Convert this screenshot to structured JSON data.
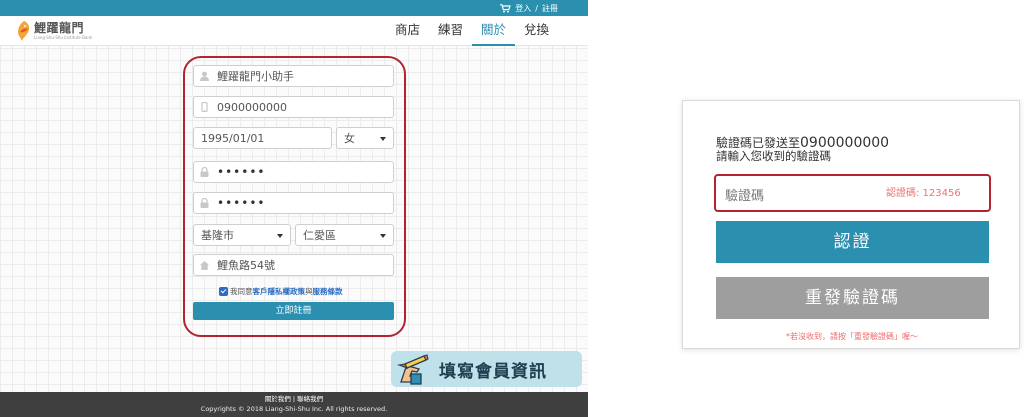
{
  "site": {
    "topbar": {
      "cart_icon": "cart-icon",
      "login_label": "登入",
      "separator": "/",
      "register_label": "註冊"
    },
    "logo": {
      "name": "鯉躍龍門",
      "tagline": "Liang-Shu-Shu Institute Bank"
    },
    "nav": {
      "items": [
        "商店",
        "練習",
        "關於",
        "兌換"
      ],
      "active": "關於"
    },
    "form": {
      "name_value": "鯉躍龍門小助手",
      "phone_value": "0900000000",
      "birthday_value": "1995/01/01",
      "gender_value": "女",
      "password_value": "••••••",
      "confirm_password_value": "••••••",
      "city_value": "基隆市",
      "district_value": "仁愛區",
      "address_value": "鯉魚路54號",
      "agree_prefix": "我同意",
      "privacy_link": "客戶隱私權政策",
      "agree_and": "與",
      "terms_link": "服務條款",
      "agreed": true,
      "submit_label": "立即註冊"
    },
    "badge": {
      "icon": "hand-pencil-icon",
      "label": "填寫會員資訊"
    },
    "footer": {
      "about_link": "關於我們",
      "divider": "|",
      "contact_link": "聯絡我們",
      "copyright": "Copyrights © 2018 Liang-Shi-Shu Inc. All rights reserved."
    }
  },
  "verify": {
    "message_prefix": "驗證碼已發送至",
    "phone": "0900000000",
    "message_line2": "請輸入您收到的驗證碼",
    "code_placeholder": "驗證碼",
    "code_hint": "認證碼: 123456",
    "verify_label": "認證",
    "resend_label": "重發驗證碼",
    "resend_note": "*若沒收到，請按「重發驗證碼」喔～"
  },
  "colors": {
    "primary": "#2b8fb0",
    "highlight": "#b32432",
    "secondary_button": "#9e9e9e",
    "hint": "#ef7272",
    "footer": "#3f3f3f"
  }
}
